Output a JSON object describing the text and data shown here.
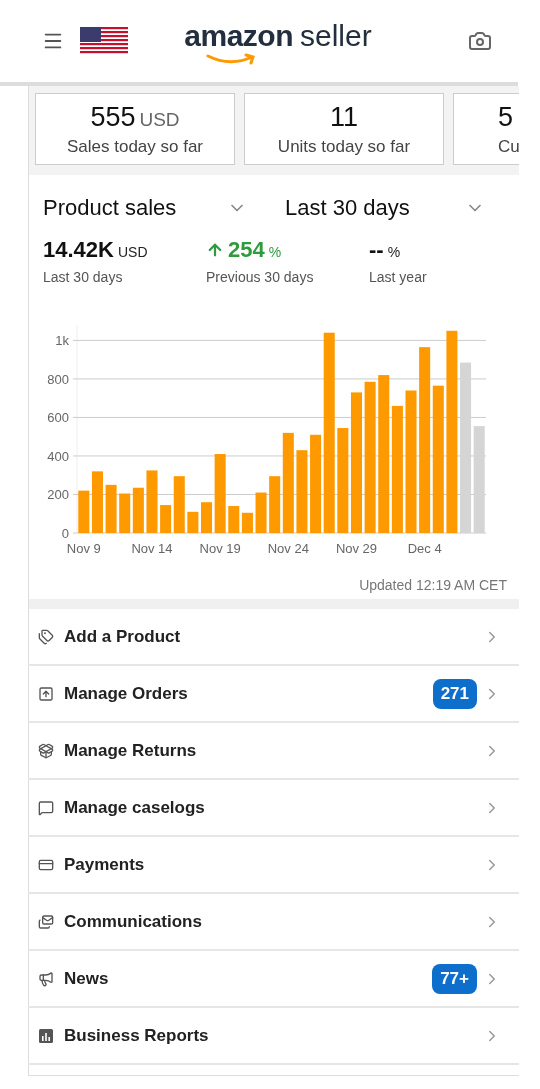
{
  "header": {
    "logo_brand": "amazon",
    "logo_suffix": "seller"
  },
  "summary_cards": [
    {
      "value": "555",
      "unit": "USD",
      "label": "Sales today so far"
    },
    {
      "value": "11",
      "label": "Units today so far"
    },
    {
      "value": "5",
      "label": "Cu"
    }
  ],
  "selectors": [
    {
      "label": "Product sales"
    },
    {
      "label": "Last 30 days"
    }
  ],
  "stats": [
    {
      "value": "14.42K",
      "unit": "USD",
      "label": "Last 30 days",
      "rising": false
    },
    {
      "value": "254",
      "unit": "%",
      "label": "Previous 30 days",
      "rising": true
    },
    {
      "value": "--",
      "unit": "%",
      "label": "Last year",
      "rising": false
    }
  ],
  "chart_data": {
    "type": "bar",
    "stacked": true,
    "grid": true,
    "categories": [
      "Nov 9",
      null,
      null,
      null,
      null,
      "Nov 14",
      null,
      null,
      null,
      null,
      "Nov 19",
      null,
      null,
      null,
      null,
      "Nov 24",
      null,
      null,
      null,
      null,
      "Nov 29",
      null,
      null,
      null,
      null,
      "Dec 4",
      null,
      null,
      null,
      null
    ],
    "yticks": [
      0,
      200,
      400,
      600,
      800,
      {
        "value": 1000,
        "label": "1k"
      }
    ],
    "ylim": [
      0,
      1080
    ],
    "series": [
      {
        "color": "#ff9900",
        "values": [
          220,
          320,
          250,
          205,
          235,
          325,
          145,
          295,
          110,
          160,
          410,
          140,
          105,
          210,
          295,
          520,
          430,
          510,
          1040,
          545,
          730,
          785,
          820,
          660,
          740,
          965,
          765,
          1050,
          null,
          null
        ]
      },
      {
        "color": "#d5d5d5",
        "values": [
          null,
          null,
          null,
          null,
          null,
          null,
          null,
          null,
          null,
          null,
          null,
          null,
          null,
          null,
          null,
          null,
          null,
          null,
          null,
          null,
          null,
          null,
          null,
          null,
          null,
          null,
          null,
          null,
          885,
          555
        ]
      }
    ]
  },
  "updated": "Updated 12:19 AM CET",
  "menu": [
    {
      "label": "Add a Product"
    },
    {
      "label": "Manage Orders",
      "badge": "271"
    },
    {
      "label": "Manage Returns"
    },
    {
      "label": "Manage caselogs"
    },
    {
      "label": "Payments"
    },
    {
      "label": "Communications"
    },
    {
      "label": "News",
      "badge": "77+"
    },
    {
      "label": "Business Reports"
    }
  ]
}
